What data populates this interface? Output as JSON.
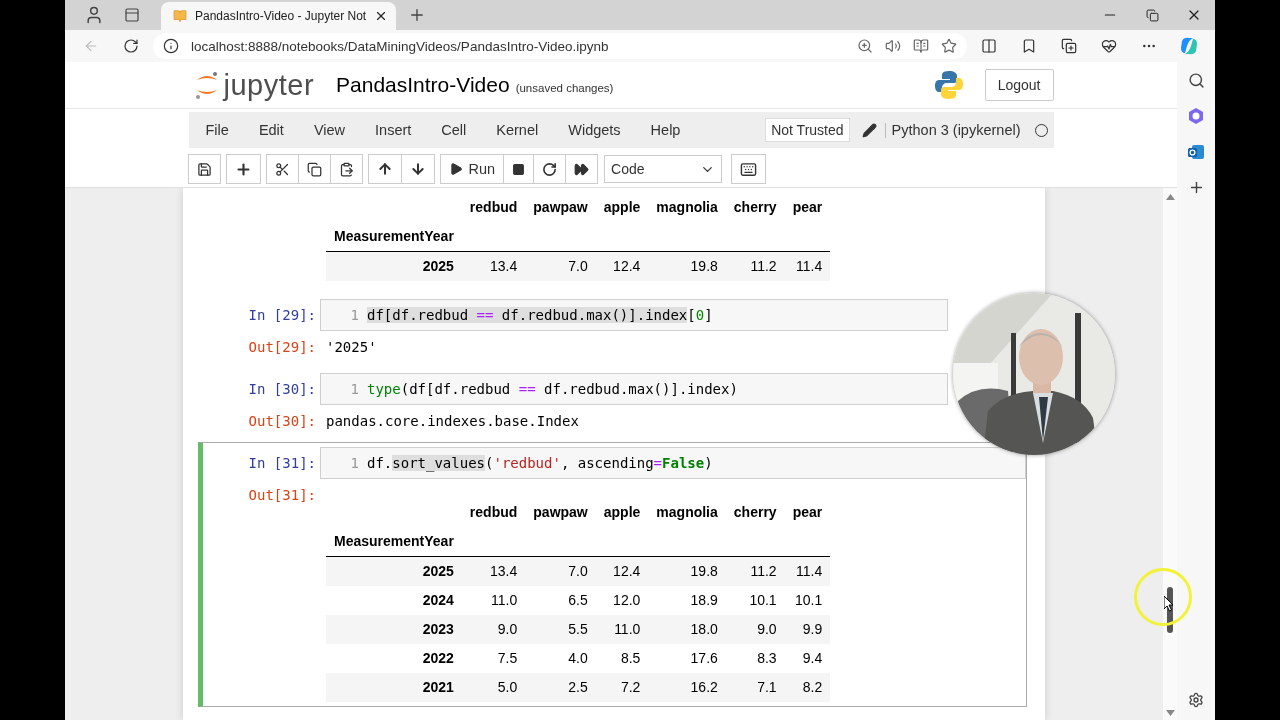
{
  "browser": {
    "tabs": [
      {
        "title": "PandasIntro-Video - Jupyter Not",
        "selected": true
      }
    ],
    "url": "localhost:8888/notebooks/DataMiningVideos/PandasIntro-Video.ipynb"
  },
  "header": {
    "logo": "jupyter",
    "title": "PandasIntro-Video",
    "save_status": "(unsaved changes)",
    "logout": "Logout"
  },
  "menu": {
    "items": [
      "File",
      "Edit",
      "View",
      "Insert",
      "Cell",
      "Kernel",
      "Widgets",
      "Help"
    ],
    "trust": "Not Trusted",
    "kernel": "Python 3 (ipykernel)",
    "kernel_busy": false
  },
  "toolbar": {
    "run": "Run",
    "cell_type": "Code"
  },
  "cells": [
    {
      "kind": "output",
      "selected": false,
      "output": {
        "kind": "dataframe",
        "columns": [
          "redbud",
          "pawpaw",
          "apple",
          "magnolia",
          "cherry",
          "pear"
        ],
        "index_name": "MeasurementYear",
        "rows": [
          {
            "index": "2025",
            "values": [
              "13.4",
              "7.0",
              "12.4",
              "19.8",
              "11.2",
              "11.4"
            ]
          }
        ]
      }
    },
    {
      "kind": "code",
      "selected": false,
      "prompt": "In [29]:",
      "line": "1",
      "tokens": [
        {
          "t": "df[df.redbud ",
          "kind": "plain",
          "marked": true
        },
        {
          "t": "==",
          "kind": "op",
          "marked": true
        },
        {
          "t": " df.redbud.max()].index",
          "kind": "plain",
          "marked": true
        },
        {
          "t": "[",
          "kind": "plain",
          "marked": false
        },
        {
          "t": "0",
          "kind": "number",
          "marked": false
        },
        {
          "t": "]",
          "kind": "plain",
          "marked": false
        }
      ],
      "output": {
        "kind": "text",
        "prompt": "Out[29]:",
        "text": "'2025'"
      }
    },
    {
      "kind": "code",
      "selected": false,
      "prompt": "In [30]:",
      "line": "1",
      "tokens": [
        {
          "t": "type",
          "kind": "builtin",
          "marked": false
        },
        {
          "t": "(df[df.redbud ",
          "kind": "plain",
          "marked": false
        },
        {
          "t": "==",
          "kind": "op",
          "marked": false
        },
        {
          "t": " df.redbud.max()].index)",
          "kind": "plain",
          "marked": false
        }
      ],
      "output": {
        "kind": "text",
        "prompt": "Out[30]:",
        "text": "pandas.core.indexes.base.Index"
      }
    },
    {
      "kind": "code",
      "selected": true,
      "prompt": "In [31]:",
      "line": "1",
      "tokens": [
        {
          "t": "df.",
          "kind": "plain",
          "marked": false
        },
        {
          "t": "sort_values",
          "kind": "plain",
          "marked": true
        },
        {
          "t": "(",
          "kind": "plain",
          "marked": false
        },
        {
          "t": "'redbud'",
          "kind": "string",
          "marked": false
        },
        {
          "t": ", ascending",
          "kind": "plain",
          "marked": false
        },
        {
          "t": "=",
          "kind": "op",
          "marked": false
        },
        {
          "t": "False",
          "kind": "keyword",
          "marked": false
        },
        {
          "t": ")",
          "kind": "plain",
          "marked": false
        }
      ],
      "output": {
        "kind": "dataframe",
        "prompt": "Out[31]:",
        "columns": [
          "redbud",
          "pawpaw",
          "apple",
          "magnolia",
          "cherry",
          "pear"
        ],
        "index_name": "MeasurementYear",
        "rows": [
          {
            "index": "2025",
            "values": [
              "13.4",
              "7.0",
              "12.4",
              "19.8",
              "11.2",
              "11.4"
            ]
          },
          {
            "index": "2024",
            "values": [
              "11.0",
              "6.5",
              "12.0",
              "18.9",
              "10.1",
              "10.1"
            ]
          },
          {
            "index": "2023",
            "values": [
              "9.0",
              "5.5",
              "11.0",
              "18.0",
              "9.0",
              "9.9"
            ]
          },
          {
            "index": "2022",
            "values": [
              "7.5",
              "4.0",
              "8.5",
              "17.6",
              "8.3",
              "9.4"
            ]
          },
          {
            "index": "2021",
            "values": [
              "5.0",
              "2.5",
              "7.2",
              "16.2",
              "7.1",
              "8.2"
            ]
          }
        ]
      }
    }
  ]
}
